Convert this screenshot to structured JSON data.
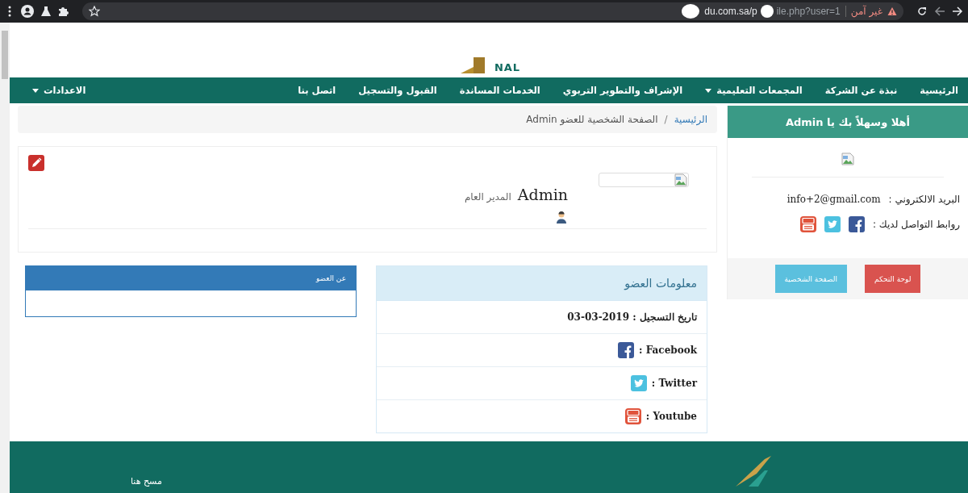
{
  "browser": {
    "security_label": "غير آمن",
    "url_head": "du.com.sa/p",
    "url_tail": "ile.php?user=1"
  },
  "header": {
    "logo_text": "NAL"
  },
  "nav": {
    "items": [
      {
        "label": "الرئيسية",
        "dropdown": false
      },
      {
        "label": "نبذة عن الشركة",
        "dropdown": false
      },
      {
        "label": "المجمعات التعليمية",
        "dropdown": true
      },
      {
        "label": "الإشراف والتطوير التربوي",
        "dropdown": false
      },
      {
        "label": "الخدمات المساندة",
        "dropdown": false
      },
      {
        "label": "القبول والتسجيل",
        "dropdown": false
      },
      {
        "label": "اتصل بنا",
        "dropdown": false
      }
    ],
    "settings": {
      "label": "الاعدادات",
      "dropdown": true
    }
  },
  "sidebar": {
    "title": "أهلا وسهلاً بك يا Admin",
    "email_label": "البريد الالكتروني :",
    "email": "info+2@gmail.com",
    "social_label": "روابط التواصل لديك :",
    "social": [
      {
        "kind": "facebook"
      },
      {
        "kind": "twitter"
      },
      {
        "kind": "youtube"
      }
    ],
    "buttons": [
      {
        "label": "لوحة التحكم",
        "kind": "danger"
      },
      {
        "label": "الصفحة الشخصية",
        "kind": "info"
      }
    ]
  },
  "breadcrumb": {
    "separator": "/",
    "items": [
      {
        "label": "الرئيسية",
        "link": true
      },
      {
        "label": "الصفحة الشخصية للعضو Admin",
        "link": false
      }
    ]
  },
  "profile": {
    "name": "Admin",
    "role": "المدير العام"
  },
  "member_info": {
    "title": "معلومات العضو",
    "rows": [
      {
        "kind": "date",
        "label": "تاريخ التسجيل :",
        "value": "03-03-2019"
      },
      {
        "kind": "facebook",
        "label": "Facebook :"
      },
      {
        "kind": "twitter",
        "label": "Twitter :"
      },
      {
        "kind": "youtube",
        "label": "Youtube :"
      }
    ]
  },
  "about": {
    "title": "عن العضو"
  },
  "footer": {
    "text": "مسح هنا"
  }
}
